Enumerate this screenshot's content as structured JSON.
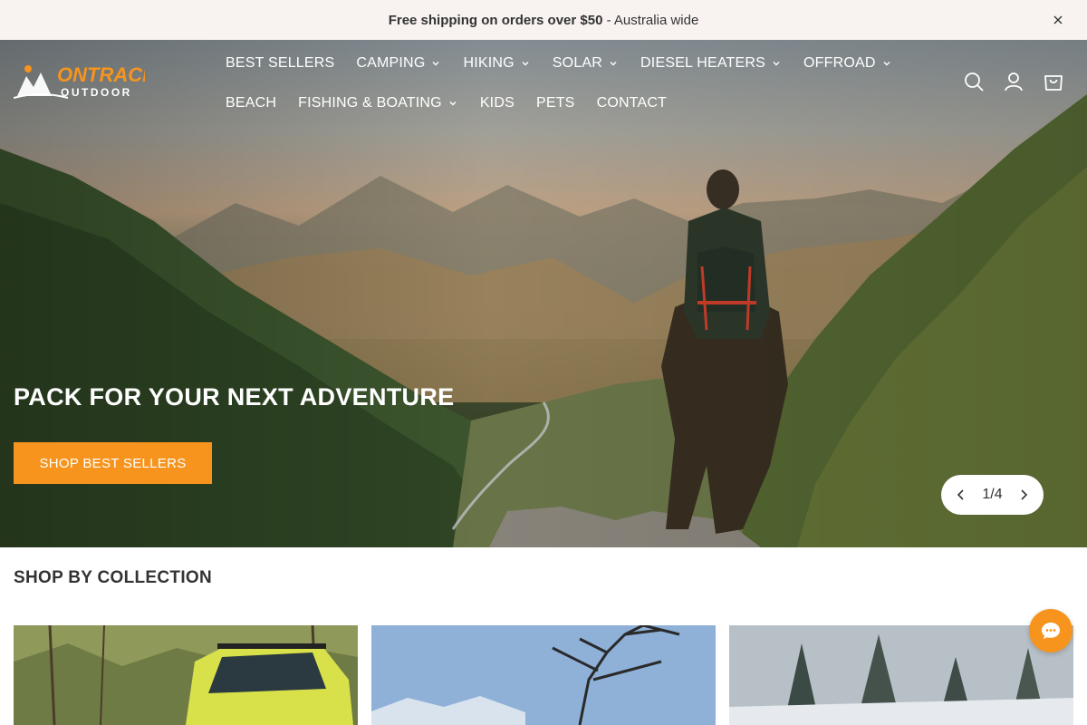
{
  "announcement": {
    "bold": "Free shipping on orders over $50",
    "rest": " - Australia wide"
  },
  "brand": {
    "logo_top": "ONTRACK",
    "logo_bottom": "OUTDOOR",
    "accent": "#f7941d"
  },
  "nav": {
    "row1": [
      {
        "label": "BEST SELLERS",
        "dropdown": false
      },
      {
        "label": "CAMPING",
        "dropdown": true
      },
      {
        "label": "HIKING",
        "dropdown": true
      },
      {
        "label": "SOLAR",
        "dropdown": true
      },
      {
        "label": "DIESEL HEATERS",
        "dropdown": true
      },
      {
        "label": "OFFROAD",
        "dropdown": true
      }
    ],
    "row2": [
      {
        "label": "BEACH",
        "dropdown": false
      },
      {
        "label": "FISHING & BOATING",
        "dropdown": true
      },
      {
        "label": "KIDS",
        "dropdown": false
      },
      {
        "label": "PETS",
        "dropdown": false
      },
      {
        "label": "CONTACT",
        "dropdown": false
      }
    ]
  },
  "header_icons": [
    "search-icon",
    "account-icon",
    "cart-icon"
  ],
  "hero": {
    "title": "PACK FOR YOUR NEXT ADVENTURE",
    "button": "SHOP BEST SELLERS",
    "slide_counter": "1/4"
  },
  "collections": {
    "title": "SHOP BY COLLECTION"
  }
}
